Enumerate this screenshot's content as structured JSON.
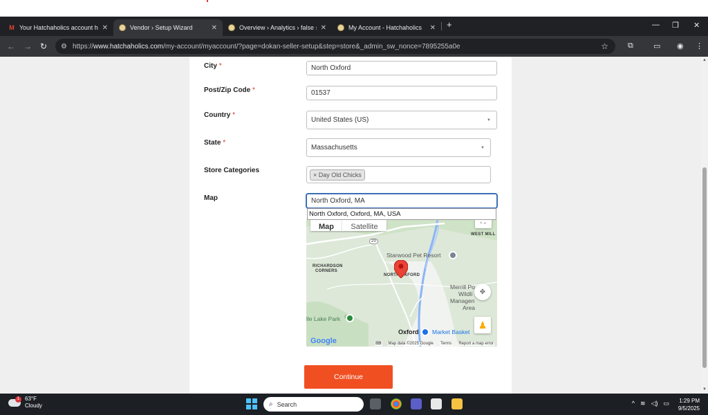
{
  "browser": {
    "tabs": [
      {
        "title": "Your Hatchaholics account has",
        "active": false,
        "icon": "gmail-icon"
      },
      {
        "title": "Vendor › Setup Wizard",
        "active": true,
        "icon": "egg-icon"
      },
      {
        "title": "Overview › Analytics › false › Ha",
        "active": false,
        "icon": "egg-icon"
      },
      {
        "title": "My Account - Hatchaholics",
        "active": false,
        "icon": "egg-icon"
      }
    ],
    "url_prefix": "https://",
    "url_domain": "www.hatchaholics.com",
    "url_path": "/my-account/myaccount/?page=dokan-seller-setup&step=store&_admin_sw_nonce=7895255a0e"
  },
  "form": {
    "city": {
      "label": "City",
      "required": "*",
      "value": "North Oxford"
    },
    "zip": {
      "label": "Post/Zip Code",
      "required": "*",
      "value": "01537"
    },
    "country": {
      "label": "Country",
      "required": "*",
      "value": "United States (US)"
    },
    "state": {
      "label": "State",
      "required": "*",
      "value": "Massachusetts"
    },
    "categories": {
      "label": "Store Categories",
      "tag": "× Day Old Chicks"
    },
    "map": {
      "label": "Map",
      "value": "North Oxford, MA",
      "suggestion": "North Oxford, Oxford, MA, USA"
    },
    "continue_label": "Continue"
  },
  "map_view": {
    "tab_map": "Map",
    "tab_satellite": "Satellite",
    "places": {
      "west_mill": "WEST MILL",
      "starwood": "Starwood Pet Resort",
      "richardson": "RICHARDSON",
      "corners": "CORNERS",
      "north_oxford": "NORTH OXFORD",
      "merrill_1": "Merrill Po",
      "merrill_2": "Wildli",
      "merrill_3": "Managen",
      "merrill_4": "Area",
      "lake_park": "lle Lake Park",
      "oxford": "Oxford",
      "market_basket": "Market Basket",
      "route_20": "20"
    },
    "footer": {
      "google": "Google",
      "keyboard": "⌨",
      "data": "Map data ©2025 Google",
      "terms": "Terms",
      "report": "Report a map error"
    }
  },
  "taskbar": {
    "temp": "63°F",
    "condition": "Cloudy",
    "badge": "1",
    "search_placeholder": "Search",
    "time": "1:29 PM",
    "date": "9/5/2025"
  }
}
